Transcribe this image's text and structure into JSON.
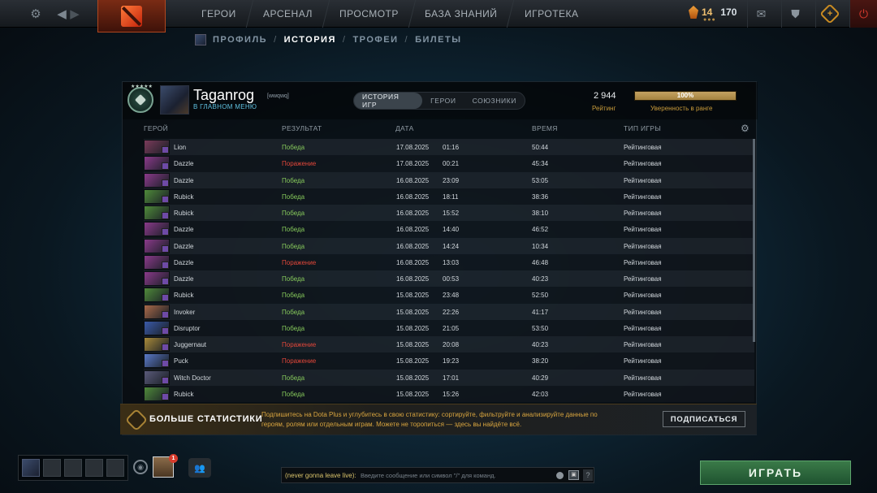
{
  "topnav": {
    "items": [
      "ГЕРОИ",
      "АРСЕНАЛ",
      "ПРОСМОТР",
      "БАЗА ЗНАНИЙ",
      "ИГРОТЕКА"
    ],
    "shards": "14",
    "coins": "170",
    "icons": {
      "settings": "gear-icon",
      "back": "arrow-left-icon",
      "forward": "arrow-right-icon",
      "mail": "mail-icon",
      "armory": "armory-icon",
      "plus": "dota-plus-icon",
      "power": "power-icon"
    }
  },
  "subnav": {
    "items": [
      "ПРОФИЛЬ",
      "ИСТОРИЯ",
      "ТРОФЕИ",
      "БИЛЕТЫ"
    ],
    "active": "ИСТОРИЯ"
  },
  "profile": {
    "name": "Taganrog",
    "tag": "[wwqwq]",
    "status": "В ГЛАВНОМ МЕНЮ",
    "rating_value": "2 944",
    "rating_label": "Рейтинг",
    "confidence_value": "100%",
    "confidence_label": "Уверенность в ранге",
    "confidence_fraction": 1.0
  },
  "tabs": [
    "ИСТОРИЯ ИГР",
    "ГЕРОИ",
    "СОЮЗНИКИ"
  ],
  "columns": {
    "hero": "ГЕРОЙ",
    "result": "РЕЗУЛЬТАТ",
    "date": "ДАТА",
    "duration": "ВРЕМЯ",
    "mode": "ТИП ИГРЫ"
  },
  "matches": [
    {
      "hero": "Lion",
      "result": "Победа",
      "win": true,
      "date": "17.08.2025",
      "time": "01:16",
      "duration": "50:44",
      "mode": "Рейтинговая",
      "color": "#7a3b5a"
    },
    {
      "hero": "Dazzle",
      "result": "Поражение",
      "win": false,
      "date": "17.08.2025",
      "time": "00:21",
      "duration": "45:34",
      "mode": "Рейтинговая",
      "color": "#8a3a8a"
    },
    {
      "hero": "Dazzle",
      "result": "Победа",
      "win": true,
      "date": "16.08.2025",
      "time": "23:09",
      "duration": "53:05",
      "mode": "Рейтинговая",
      "color": "#8a3a8a"
    },
    {
      "hero": "Rubick",
      "result": "Победа",
      "win": true,
      "date": "16.08.2025",
      "time": "18:11",
      "duration": "38:36",
      "mode": "Рейтинговая",
      "color": "#4f8a3a"
    },
    {
      "hero": "Rubick",
      "result": "Победа",
      "win": true,
      "date": "16.08.2025",
      "time": "15:52",
      "duration": "38:10",
      "mode": "Рейтинговая",
      "color": "#4f8a3a"
    },
    {
      "hero": "Dazzle",
      "result": "Победа",
      "win": true,
      "date": "16.08.2025",
      "time": "14:40",
      "duration": "46:52",
      "mode": "Рейтинговая",
      "color": "#8a3a8a"
    },
    {
      "hero": "Dazzle",
      "result": "Победа",
      "win": true,
      "date": "16.08.2025",
      "time": "14:24",
      "duration": "10:34",
      "mode": "Рейтинговая",
      "color": "#8a3a8a"
    },
    {
      "hero": "Dazzle",
      "result": "Поражение",
      "win": false,
      "date": "16.08.2025",
      "time": "13:03",
      "duration": "46:48",
      "mode": "Рейтинговая",
      "color": "#8a3a8a"
    },
    {
      "hero": "Dazzle",
      "result": "Победа",
      "win": true,
      "date": "16.08.2025",
      "time": "00:53",
      "duration": "40:23",
      "mode": "Рейтинговая",
      "color": "#8a3a8a"
    },
    {
      "hero": "Rubick",
      "result": "Победа",
      "win": true,
      "date": "15.08.2025",
      "time": "23:48",
      "duration": "52:50",
      "mode": "Рейтинговая",
      "color": "#4f8a3a"
    },
    {
      "hero": "Invoker",
      "result": "Победа",
      "win": true,
      "date": "15.08.2025",
      "time": "22:26",
      "duration": "41:17",
      "mode": "Рейтинговая",
      "color": "#a86a4a"
    },
    {
      "hero": "Disruptor",
      "result": "Победа",
      "win": true,
      "date": "15.08.2025",
      "time": "21:05",
      "duration": "53:50",
      "mode": "Рейтинговая",
      "color": "#3a5aa8"
    },
    {
      "hero": "Juggernaut",
      "result": "Поражение",
      "win": false,
      "date": "15.08.2025",
      "time": "20:08",
      "duration": "40:23",
      "mode": "Рейтинговая",
      "color": "#a88a3a"
    },
    {
      "hero": "Puck",
      "result": "Поражение",
      "win": false,
      "date": "15.08.2025",
      "time": "19:23",
      "duration": "38:20",
      "mode": "Рейтинговая",
      "color": "#5a7ac8"
    },
    {
      "hero": "Witch Doctor",
      "result": "Победа",
      "win": true,
      "date": "15.08.2025",
      "time": "17:01",
      "duration": "40:29",
      "mode": "Рейтинговая",
      "color": "#5a5a7a"
    },
    {
      "hero": "Rubick",
      "result": "Победа",
      "win": true,
      "date": "15.08.2025",
      "time": "15:26",
      "duration": "42:03",
      "mode": "Рейтинговая",
      "color": "#4f8a3a"
    }
  ],
  "dota_plus": {
    "title": "БОЛЬШЕ СТАТИСТИКИ",
    "text": "Подпишитесь на Dota Plus и углубитесь в свою статистику: сортируйте, фильтруйте и анализируйте данные по героям, ролям или отдельным играм. Можете не торопиться — здесь вы найдёте всё.",
    "button": "ПОДПИСАТЬСЯ"
  },
  "bottom": {
    "chat_channel": "(never gonna leave live):",
    "chat_placeholder": "Введите сообщение или символ \"/\" для команд.",
    "chest_count": "1",
    "play": "ИГРАТЬ",
    "help": "?"
  },
  "colors": {
    "win": "#86c95b",
    "loss": "#e2473a",
    "gold": "#c79a3a",
    "play": "#2f6a3d"
  }
}
